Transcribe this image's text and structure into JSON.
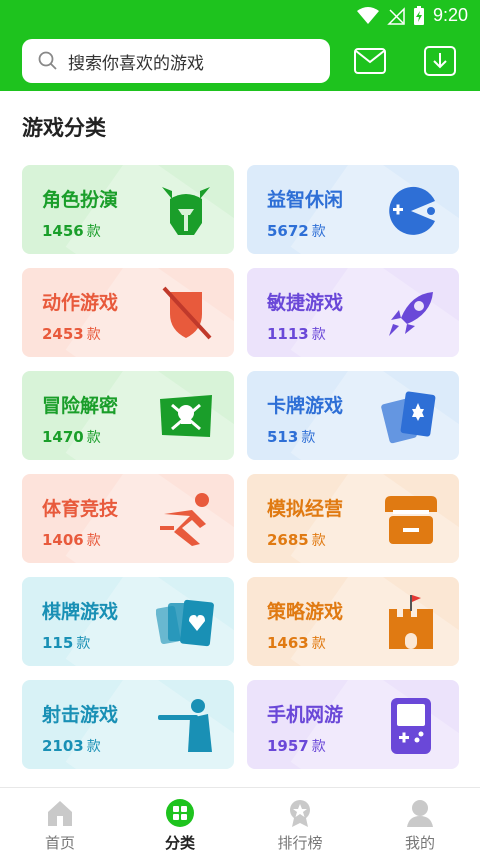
{
  "status": {
    "time": "9:20"
  },
  "search": {
    "placeholder": "搜索你喜欢的游戏"
  },
  "header": {
    "mail_icon": "mail-icon",
    "download_icon": "download-icon"
  },
  "section_title": "游戏分类",
  "unit": "款",
  "categories": [
    {
      "name": "角色扮演",
      "count": "1456",
      "icon": "warrior-helmet-icon",
      "bg": "#d8f3d8",
      "color": "#1a9e2a"
    },
    {
      "name": "益智休闲",
      "count": "5672",
      "icon": "pacman-icon",
      "bg": "#dcebfa",
      "color": "#2e6fd6"
    },
    {
      "name": "动作游戏",
      "count": "2453",
      "icon": "sword-shield-icon",
      "bg": "#fde3db",
      "color": "#e85a3c"
    },
    {
      "name": "敏捷游戏",
      "count": "1113",
      "icon": "rocket-icon",
      "bg": "#ece3fb",
      "color": "#6a48d8"
    },
    {
      "name": "冒险解密",
      "count": "1470",
      "icon": "skull-flag-icon",
      "bg": "#d8f3d8",
      "color": "#1a9e2a"
    },
    {
      "name": "卡牌游戏",
      "count": "513",
      "icon": "cards-star-icon",
      "bg": "#dcebfa",
      "color": "#2e6fd6"
    },
    {
      "name": "体育竞技",
      "count": "1406",
      "icon": "runner-icon",
      "bg": "#fde3db",
      "color": "#e85a3c"
    },
    {
      "name": "模拟经营",
      "count": "2685",
      "icon": "shop-icon",
      "bg": "#fbe7d4",
      "color": "#e07a12"
    },
    {
      "name": "棋牌游戏",
      "count": "115",
      "icon": "playing-cards-icon",
      "bg": "#d8f2f6",
      "color": "#1990b5"
    },
    {
      "name": "策略游戏",
      "count": "1463",
      "icon": "castle-icon",
      "bg": "#fbe7d4",
      "color": "#e07a12"
    },
    {
      "name": "射击游戏",
      "count": "2103",
      "icon": "shooter-icon",
      "bg": "#d8f2f6",
      "color": "#1990b5"
    },
    {
      "name": "手机网游",
      "count": "1957",
      "icon": "handheld-console-icon",
      "bg": "#ece3fb",
      "color": "#6a48d8"
    }
  ],
  "tabs": [
    {
      "label": "首页",
      "icon": "home-icon",
      "active": false
    },
    {
      "label": "分类",
      "icon": "category-icon",
      "active": true
    },
    {
      "label": "排行榜",
      "icon": "rank-icon",
      "active": false
    },
    {
      "label": "我的",
      "icon": "profile-icon",
      "active": false
    }
  ]
}
